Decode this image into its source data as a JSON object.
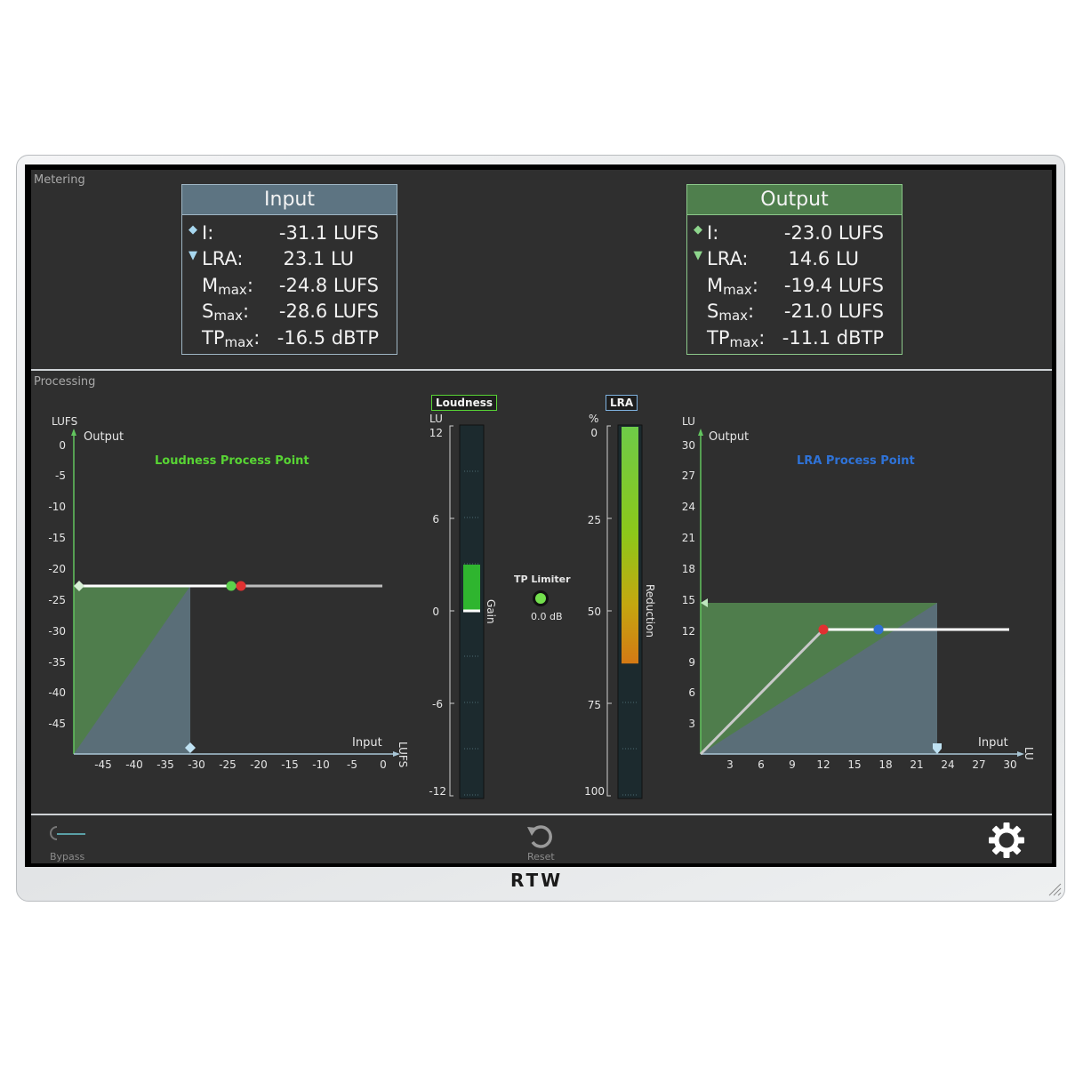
{
  "metering": {
    "section_label": "Metering",
    "input": {
      "title": "Input",
      "rows": [
        {
          "label": "I:",
          "value": "-31.1 LUFS"
        },
        {
          "label": "LRA:",
          "value": "23.1 LU"
        },
        {
          "label_main": "M",
          "label_sub": "max",
          "label_end": ":",
          "value": "-24.8 LUFS"
        },
        {
          "label_main": "S",
          "label_sub": "max",
          "label_end": ":",
          "value": "-28.6 LUFS"
        },
        {
          "label_main": "TP",
          "label_sub": "max",
          "label_end": ":",
          "value": "-16.5 dBTP"
        }
      ]
    },
    "output": {
      "title": "Output",
      "rows": [
        {
          "label": "I:",
          "value": "-23.0 LUFS"
        },
        {
          "label": "LRA:",
          "value": "14.6 LU"
        },
        {
          "label_main": "M",
          "label_sub": "max",
          "label_end": ":",
          "value": "-19.4 LUFS"
        },
        {
          "label_main": "S",
          "label_sub": "max",
          "label_end": ":",
          "value": "-21.0 LUFS"
        },
        {
          "label_main": "TP",
          "label_sub": "max",
          "label_end": ":",
          "value": "-11.1 dBTP"
        }
      ]
    }
  },
  "processing": {
    "section_label": "Processing",
    "loudness_chart": {
      "title": "Loudness Process Point",
      "y_unit": "LUFS",
      "y_axis_label": "Output",
      "x_axis_label": "Input",
      "x_unit": "LUFS",
      "y_ticks": [
        "0",
        "-5",
        "-10",
        "-15",
        "-20",
        "-25",
        "-30",
        "-35",
        "-40",
        "-45"
      ],
      "x_ticks": [
        "-45",
        "-40",
        "-35",
        "-30",
        "-25",
        "-20",
        "-15",
        "-10",
        "-5",
        "0"
      ]
    },
    "loudness_meter": {
      "tag": "Loudness",
      "unit": "LU",
      "ticks": [
        "12",
        "6",
        "0",
        "-6",
        "-12"
      ],
      "side_label": "Gain",
      "gain_lu": 3
    },
    "tp_limiter": {
      "label": "TP Limiter",
      "value": "0.0 dB"
    },
    "lra_meter": {
      "tag": "LRA",
      "unit": "%",
      "ticks": [
        "0",
        "25",
        "50",
        "75",
        "100"
      ],
      "side_label": "Reduction",
      "reduction_percent": 64
    },
    "lra_chart": {
      "title": "LRA Process Point",
      "y_unit": "LU",
      "y_axis_label": "Output",
      "x_axis_label": "Input",
      "x_unit": "LU",
      "y_ticks": [
        "30",
        "27",
        "24",
        "21",
        "18",
        "15",
        "12",
        "9",
        "6",
        "3"
      ],
      "x_ticks": [
        "3",
        "6",
        "9",
        "12",
        "15",
        "18",
        "21",
        "24",
        "27",
        "30"
      ]
    }
  },
  "footer": {
    "bypass_label": "Bypass",
    "reset_label": "Reset",
    "settings_icon": "gear-icon",
    "brand": "RTW"
  },
  "colors": {
    "input_accent": "#5d7482",
    "output_accent": "#4f7f4d",
    "loudness_title": "#58d434",
    "lra_title": "#2f73d8",
    "axis_green": "#62c45e",
    "marker_red": "#e03131",
    "marker_green": "#5ccf4c",
    "marker_blue": "#2f6fd0"
  }
}
